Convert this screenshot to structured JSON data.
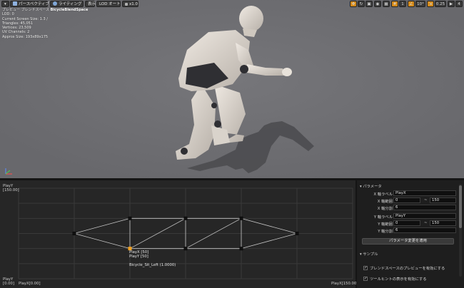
{
  "toolbar": {
    "perspective": "パースペクティブ",
    "lighting": "ライティング",
    "show": "表示",
    "lod": "LOD オート",
    "speed": "x1.0"
  },
  "toolbar_right": {
    "grid_value": "1",
    "angle_value": "10°",
    "scale_value": "0.25",
    "camera_speed": "4"
  },
  "viewport_info": {
    "title_prefix": "プレビュー ブレンドスペース ",
    "title_asset": "BicycleBlendSpace",
    "lines": [
      "LOD: 0",
      "Current Screen Size: 1.3 /",
      "Triangles: 45,051",
      "Vertices: 23,509",
      "UV Channels: 2",
      "Approx Size: 193x89x175"
    ]
  },
  "graph": {
    "y_axis_name_top": "PlayY",
    "y_max_label": "[150.00]",
    "y_axis_name_bottom": "PlayY",
    "y_min_label": "[0.00]",
    "x_min_label": "PlayX[0.00]",
    "x_max_label": "PlayX[150.00]",
    "tooltip_x": "PlayX [50]",
    "tooltip_y": "PlayY [50]",
    "sample_label": "Bicycle_Sit_Left (1.0000)"
  },
  "graph_data": {
    "x_range": [
      0,
      150
    ],
    "y_range": [
      0,
      150
    ],
    "samples": [
      {
        "x": 25,
        "y": 75
      },
      {
        "x": 50,
        "y": 100
      },
      {
        "x": 75,
        "y": 100
      },
      {
        "x": 100,
        "y": 100
      },
      {
        "x": 125,
        "y": 75
      },
      {
        "x": 50,
        "y": 50
      },
      {
        "x": 75,
        "y": 50
      },
      {
        "x": 100,
        "y": 50
      }
    ],
    "selected_sample": {
      "x": 50,
      "y": 50
    },
    "triangles": [
      [
        0,
        1,
        5
      ],
      [
        1,
        5,
        2
      ],
      [
        5,
        2,
        6
      ],
      [
        2,
        6,
        3
      ],
      [
        6,
        3,
        7
      ],
      [
        3,
        7,
        4
      ]
    ]
  },
  "params": {
    "section_title": "パラメータ",
    "x_label_name": "X 軸ラベル",
    "x_label_value": "PlayX",
    "x_range_name": "X 軸範囲",
    "x_range_min": "0",
    "x_range_max": "150",
    "x_div_name": "X 軸分割",
    "x_div_value": "6",
    "y_label_name": "Y 軸ラベル",
    "y_label_value": "PlayY",
    "y_range_name": "Y 軸範囲",
    "y_range_min": "0",
    "y_range_max": "150",
    "y_div_name": "Y 軸分割",
    "y_div_value": "6",
    "range_sep": "~",
    "apply_button": "パラメータ変更を適用"
  },
  "sample": {
    "section_title": "サンプル",
    "preview_option": "ブレンドスペースのプレビューを有効にする",
    "tooltip_option": "ツールヒントの表示を有効にする"
  }
}
